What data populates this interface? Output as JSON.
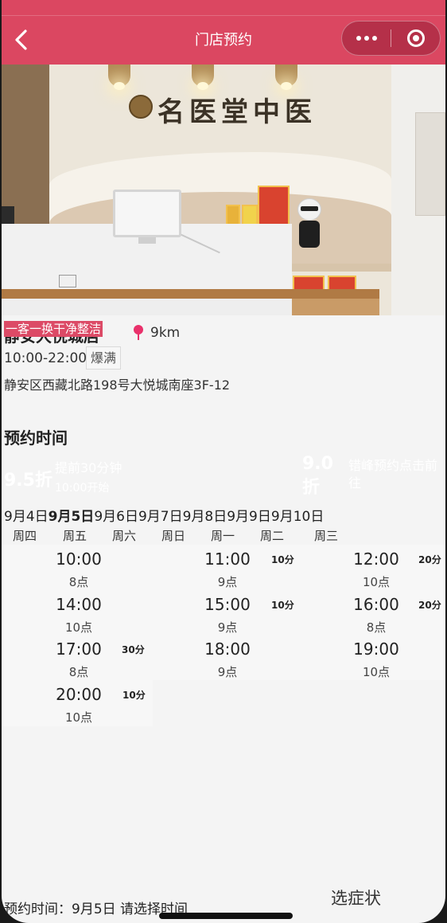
{
  "header": {
    "title": "门店预约",
    "back_icon": "chevron-left-icon",
    "more_icon": "more-dots-icon",
    "close_icon": "target-circle-icon",
    "bg_color": "#db4761"
  },
  "store": {
    "promo_tag": "一客一换干净整洁",
    "name": "静安大悦城店",
    "distance": "9km",
    "hours": "10:00-22:00",
    "status_badge": "爆满",
    "address": "静安区西藏北路198号大悦城南座3F-12",
    "sign_text": "名医堂中医"
  },
  "booking": {
    "section_title": "预约时间",
    "discounts": [
      {
        "percent": "9.5折",
        "line1": "提前30分钟",
        "line2": "10:00开始"
      },
      {
        "percent": "9.0折",
        "line1": "错峰预约点击前往"
      }
    ],
    "dates": [
      "9月4日",
      "9月5日",
      "9月6日",
      "9月7日",
      "9月8日",
      "9月9日",
      "9月10日"
    ],
    "selected_date_index": 1,
    "weekdays": [
      "周四",
      "周五",
      "周六",
      "周日",
      "周一",
      "周二",
      "周三"
    ],
    "slots": [
      {
        "time": "10:00",
        "points": "8点",
        "discount": ""
      },
      {
        "time": "11:00",
        "points": "9点",
        "discount": "10分"
      },
      {
        "time": "12:00",
        "points": "10点",
        "discount": "20分"
      },
      {
        "time": "14:00",
        "points": "10点",
        "discount": ""
      },
      {
        "time": "15:00",
        "points": "9点",
        "discount": "10分"
      },
      {
        "time": "16:00",
        "points": "8点",
        "discount": "20分"
      },
      {
        "time": "17:00",
        "points": "8点",
        "discount": "30分"
      },
      {
        "time": "18:00",
        "points": "9点",
        "discount": ""
      },
      {
        "time": "19:00",
        "points": "10点",
        "discount": ""
      },
      {
        "time": "20:00",
        "points": "10点",
        "discount": "10分"
      }
    ]
  },
  "footer": {
    "selected_time": "预约时间：9月5日 请选择时间",
    "symptom_button": "选症状"
  }
}
